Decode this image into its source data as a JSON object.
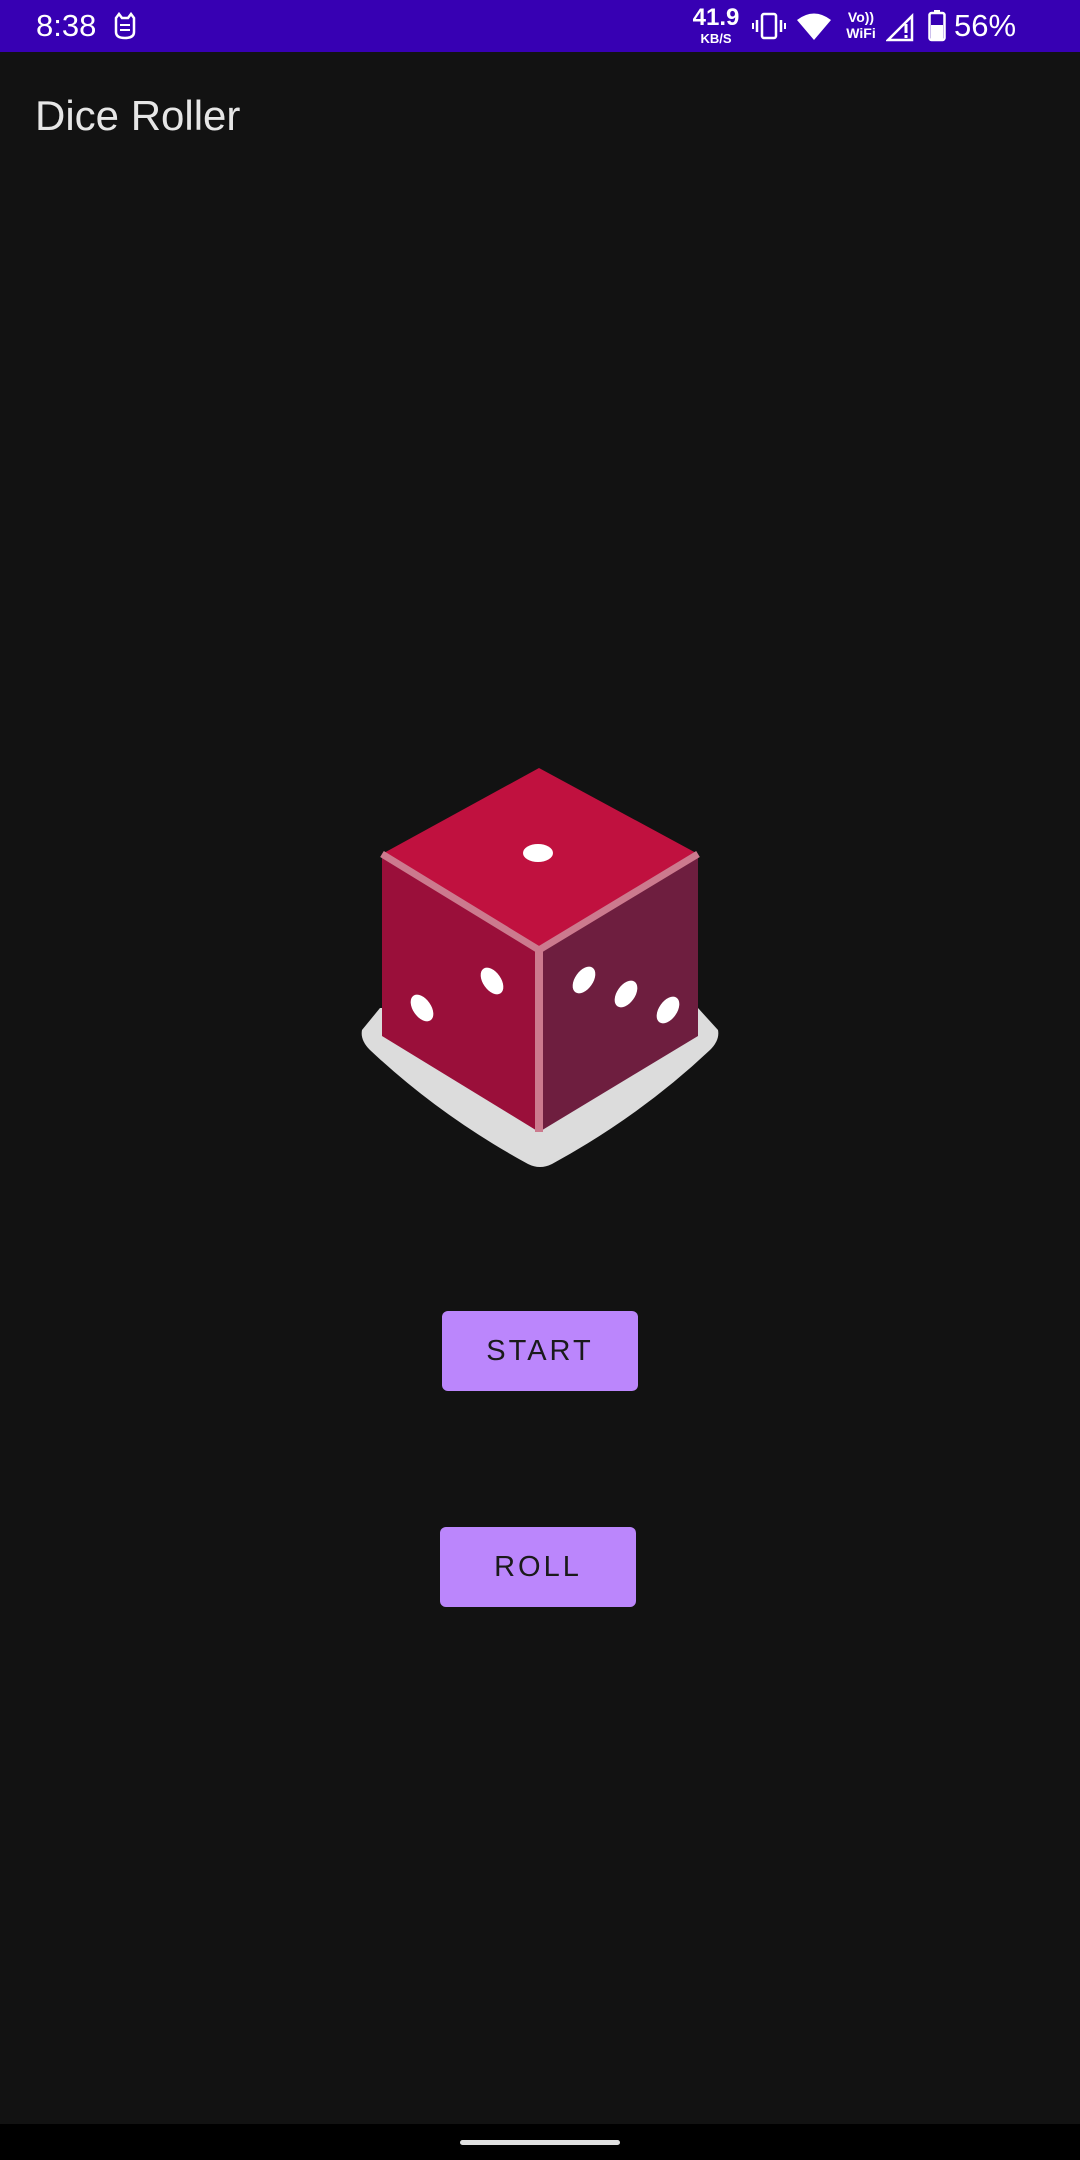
{
  "status_bar": {
    "time": "8:38",
    "notification_icon": "cat-face-icon",
    "net_speed_value": "41.9",
    "net_speed_unit": "KB/S",
    "vibrate_icon": "vibrate-icon",
    "wifi_icon": "wifi-icon",
    "volte_label_line1": "Vo))",
    "volte_label_line2": "WiFi",
    "signal_icon": "signal-no-service-icon",
    "battery_icon": "battery-icon",
    "battery": "56%",
    "background_color": "#3700B3"
  },
  "app_bar": {
    "title": "Dice Roller"
  },
  "dice": {
    "icon": "dice-icon",
    "top_face_pips": 1,
    "left_face_pips": 2,
    "right_face_pips": 3,
    "top_color": "#C0113F",
    "left_color": "#9A0F3A",
    "right_color": "#6E1E3F"
  },
  "buttons": {
    "start_label": "START",
    "roll_label": "ROLL",
    "accent_color": "#BB86FC"
  },
  "theme": {
    "background": "#121212"
  }
}
